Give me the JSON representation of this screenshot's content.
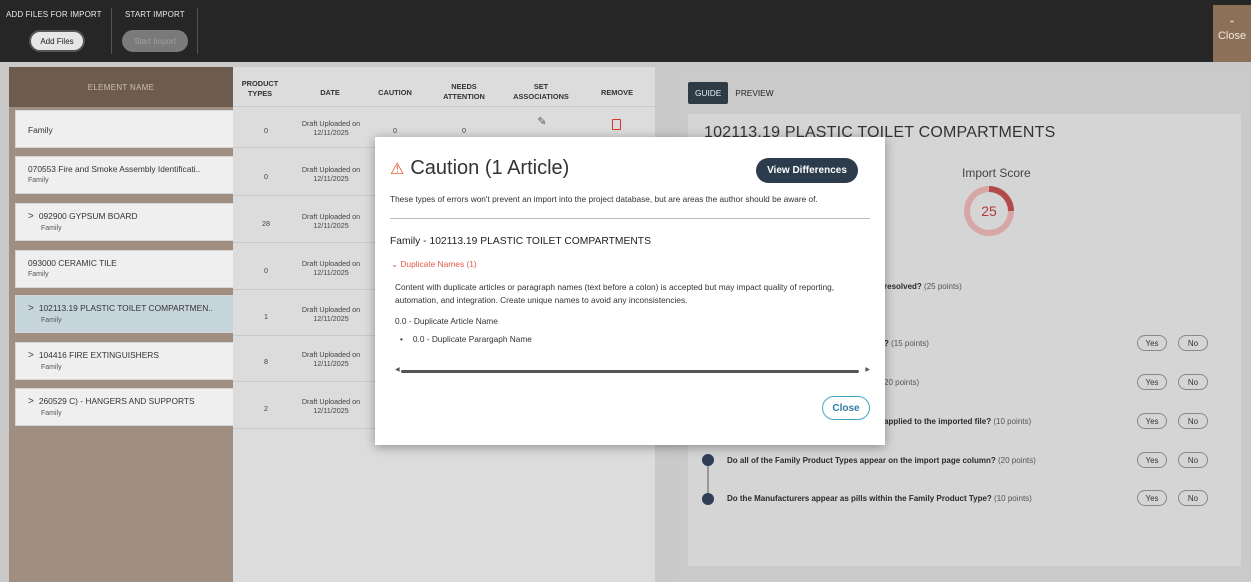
{
  "toolbar": {
    "add_group_title": "ADD FILES FOR IMPORT",
    "add_button": "Add Files",
    "start_group_title": "START IMPORT",
    "start_button": "Start Import",
    "close_label": "Close"
  },
  "element_column": {
    "header": "ELEMENT NAME",
    "items": [
      {
        "name": "Family",
        "sub": "",
        "expandable": false
      },
      {
        "name": "070553 Fire and Smoke Assembly Identificati..",
        "sub": "Family",
        "expandable": false
      },
      {
        "name": "092900 GYPSUM BOARD",
        "sub": "Family",
        "expandable": true
      },
      {
        "name": "093000 CERAMIC TILE",
        "sub": "Family",
        "expandable": false
      },
      {
        "name": "102113.19 PLASTIC TOILET COMPARTMEN..",
        "sub": "Family",
        "expandable": true,
        "selected": true
      },
      {
        "name": "104416 FIRE EXTINGUISHERS",
        "sub": "Family",
        "expandable": true
      },
      {
        "name": "260529 C) - HANGERS AND SUPPORTS",
        "sub": "Family",
        "expandable": true
      }
    ]
  },
  "table": {
    "headers": {
      "product_types": "PRODUCT TYPES",
      "date": "DATE",
      "caution": "CAUTION",
      "needs_attention": "NEEDS ATTENTION",
      "set_associations": "SET ASSOCIATIONS",
      "remove": "REMOVE"
    },
    "rows": [
      {
        "product_types": "0",
        "date": "Draft Uploaded on 12/11/2025",
        "caution": "0",
        "needs_attention": "0"
      },
      {
        "product_types": "0",
        "date": "Draft Uploaded on 12/11/2025"
      },
      {
        "product_types": "28",
        "date": "Draft Uploaded on 12/11/2025"
      },
      {
        "product_types": "0",
        "date": "Draft Uploaded on 12/11/2025"
      },
      {
        "product_types": "1",
        "date": "Draft Uploaded on 12/11/2025"
      },
      {
        "product_types": "8",
        "date": "Draft Uploaded on 12/11/2025"
      },
      {
        "product_types": "2",
        "date": "Draft Uploaded on 12/11/2025"
      }
    ]
  },
  "guide": {
    "tabs": [
      "GUIDE",
      "PREVIEW"
    ],
    "title": "102113.19 PLASTIC TOILET COMPARTMENTS",
    "score_label": "Import Score",
    "score": "25",
    "questions": [
      {
        "prefix": "resolved?",
        "points": "(25 points)"
      },
      {
        "prefix": "? ",
        "points": "(15 points)"
      },
      {
        "prefix": "",
        "points": "20 points)"
      },
      {
        "prefix": "applied to the imported file?",
        "points": "(10 points)"
      },
      {
        "prefix": "Do all of the Family Product Types appear on the import page column?",
        "points": "(20 points)"
      },
      {
        "prefix": "Do the Manufacturers appear as pills within the Family Product Type?",
        "points": "(10 points)"
      }
    ],
    "yes": "Yes",
    "no": "No"
  },
  "modal": {
    "title": "Caution (1 Article)",
    "view_differences": "View Differences",
    "subtitle": "These types of errors won't prevent an import into the project database, but are areas the author should be aware of.",
    "family_line": "Family - 102113.19 PLASTIC TOILET COMPARTMENTS",
    "dup_header": "Duplicate Names (1)",
    "description": "Content with duplicate articles or paragraph names (text before a colon) is accepted but may impact quality of reporting, automation, and integration. Create unique names to avoid any inconsistencies.",
    "article": "0.0 - Duplicate Article Name",
    "paragraph": "0.0 - Duplicate Parargaph Name",
    "close": "Close"
  },
  "colors": {
    "topbar": "#262626",
    "close_bg": "#8c7158",
    "element_header": "#6d5c4e",
    "modal_button": "#2c3c4c",
    "warning": "#e0532b",
    "remove_icon": "#d9342b"
  }
}
